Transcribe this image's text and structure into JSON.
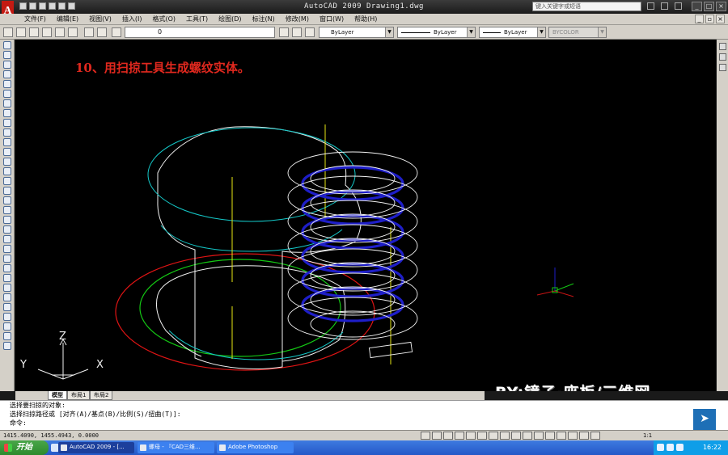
{
  "window": {
    "title": "AutoCAD 2009 Drawing1.dwg",
    "help_search_placeholder": "键入关键字或短语",
    "app_letter": "A"
  },
  "menus": [
    "文件(F)",
    "编辑(E)",
    "视图(V)",
    "插入(I)",
    "格式(O)",
    "工具(T)",
    "绘图(D)",
    "标注(N)",
    "修改(M)",
    "窗口(W)",
    "帮助(H)"
  ],
  "properties": {
    "layer_value": "0",
    "color": "ByLayer",
    "linetype": "ByLayer",
    "lineweight": "ByLayer",
    "plotstyle": "BYCOLOR"
  },
  "viewport": {
    "caption": "10、用扫掠工具生成螺纹实体。",
    "watermark": "BY:镜子·座板/三维网",
    "ucs": {
      "x": "X",
      "y": "Y",
      "z": "Z"
    }
  },
  "layout_tabs": [
    "模型",
    "布局1",
    "布局2"
  ],
  "command": {
    "lines": [
      "选择要扫掠的对象:",
      "选择扫掠路径或 [对齐(A)/基点(B)/比例(S)/扭曲(T)]:",
      "命令:"
    ]
  },
  "status": {
    "coords": "1415.4090, 1455.4943, 0.0000",
    "scale": "1:1"
  },
  "taskbar": {
    "start": "开始",
    "tasks": [
      "AutoCAD 2009 - [...",
      "螺母 - 『CAD三维...",
      "Adobe Photoshop"
    ],
    "clock": "16:22"
  },
  "colors": {
    "caption_red": "#e0281e",
    "helix_blue": "#1e1ec8",
    "ring_red": "#e01414",
    "ring_green": "#14c814",
    "ring_cyan": "#14c8c8",
    "edge_yellow": "#e6e614"
  }
}
